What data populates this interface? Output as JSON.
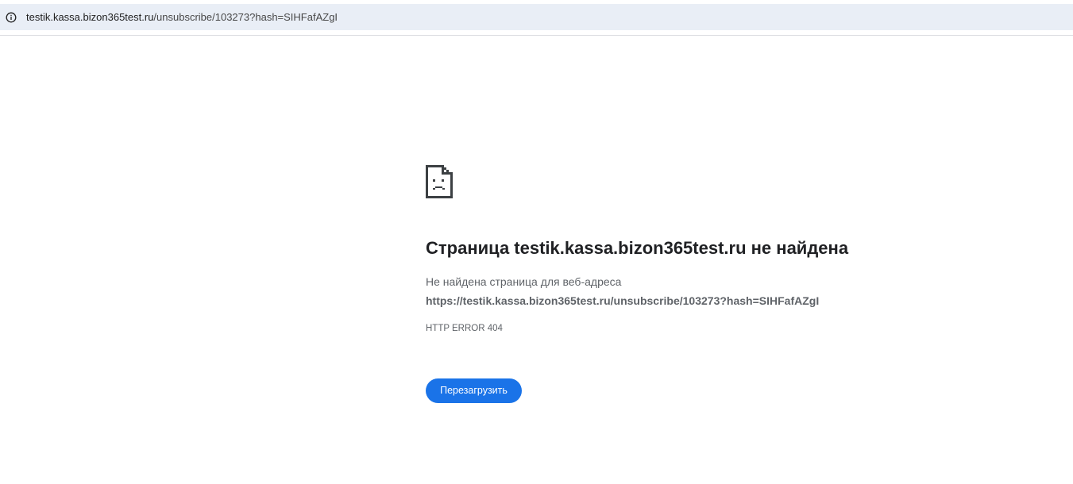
{
  "address_bar": {
    "host": "testik.kassa.bizon365test.ru",
    "path": "/unsubscribe/103273?hash=SIHFafAZgI",
    "info_icon": "info-icon"
  },
  "error_page": {
    "icon": "sad-page-icon",
    "headline": "Страница testik.kassa.bizon365test.ru не найдена",
    "description": "Не найдена страница для веб-адреса",
    "url": "https://testik.kassa.bizon365test.ru/unsubscribe/103273?hash=SIHFafAZgI",
    "error_code": "HTTP ERROR 404",
    "reload_label": "Перезагрузить"
  },
  "colors": {
    "accent": "#1a73e8",
    "omnibox_bg": "#e9eef6",
    "text_primary": "#202124",
    "text_secondary": "#5f6368"
  }
}
